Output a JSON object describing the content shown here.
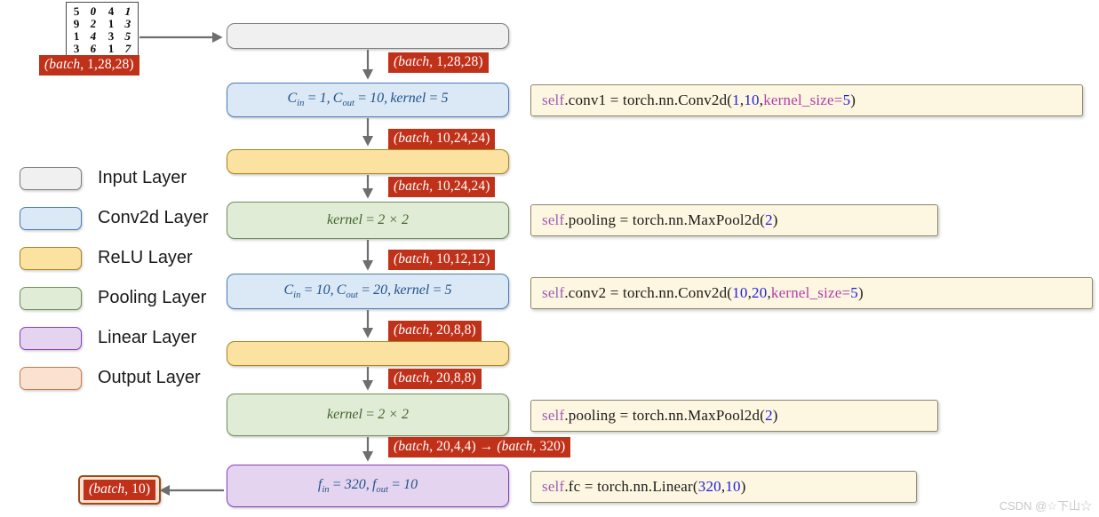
{
  "sample_image": {
    "name": "mnist-digit-grid",
    "rows": [
      [
        "5",
        "0",
        "4",
        "1"
      ],
      [
        "9",
        "2",
        "1",
        "3"
      ],
      [
        "1",
        "4",
        "3",
        "5"
      ],
      [
        "3",
        "6",
        "1",
        "7"
      ]
    ]
  },
  "input_tag": "(batch, 1,28,28)",
  "legend": {
    "items": [
      {
        "label": "Input Layer",
        "color": "#f0f0f0",
        "border": "#7f7f7f"
      },
      {
        "label": "Conv2d Layer",
        "color": "#dbe8f5",
        "border": "#4a7ebb"
      },
      {
        "label": "ReLU Layer",
        "color": "#fbe2a0",
        "border": "#a9861f"
      },
      {
        "label": "Pooling Layer",
        "color": "#e0ecd6",
        "border": "#6f8f5a"
      },
      {
        "label": "Linear Layer",
        "color": "#e5d4f0",
        "border": "#8a3fbd"
      },
      {
        "label": "Output Layer",
        "color": "#fbe2d0",
        "border": "#cd7b4a"
      }
    ]
  },
  "pipeline": {
    "blocks": [
      {
        "kind": "input",
        "label": ""
      },
      {
        "kind": "conv",
        "label": "C_in = 1, C_out = 10, kernel = 5"
      },
      {
        "kind": "relu",
        "label": ""
      },
      {
        "kind": "pool",
        "label": "kernel = 2 × 2"
      },
      {
        "kind": "conv",
        "label": "C_in = 10, C_out = 20, kernel = 5"
      },
      {
        "kind": "relu",
        "label": ""
      },
      {
        "kind": "pool",
        "label": "kernel = 2 × 2"
      },
      {
        "kind": "linear",
        "label": "f_in = 320, f_out = 10"
      }
    ],
    "conv1": {
      "c_in": "1",
      "c_out": "10",
      "kernel": "5"
    },
    "conv2": {
      "c_in": "10",
      "c_out": "20",
      "kernel": "5"
    },
    "pool1": {
      "kernel": "2 × 2"
    },
    "pool2": {
      "kernel": "2 × 2"
    },
    "fc": {
      "f_in": "320",
      "f_out": "10"
    }
  },
  "shape_tags": [
    "(batch, 1,28,28)",
    "(batch, 10,24,24)",
    "(batch, 10,24,24)",
    "(batch, 10,12,12)",
    "(batch, 20,8,8)",
    "(batch, 20,8,8)",
    "(batch, 20,4,4) → (batch, 320)"
  ],
  "output_tag": "(batch, 10)",
  "code": {
    "conv1": {
      "self": "self",
      "attr": ".conv1 = torch.nn.Conv2d(",
      "a1": "1",
      "sep1": ",  ",
      "a2": "10",
      "sep2": ",  ",
      "kw": "kernel_size",
      "eq": "=",
      "a3": "5",
      "close": ")"
    },
    "pool1": {
      "self": "self",
      "attr": ".pooling = torch.nn.MaxPool2d(",
      "a1": "2",
      "close": ")"
    },
    "conv2": {
      "self": "self",
      "attr": ".conv2 = torch.nn.Conv2d(",
      "a1": "10",
      "sep1": ",  ",
      "a2": "20",
      "sep2": ",  ",
      "kw": "kernel_size",
      "eq": "=",
      "a3": "5",
      "close": ")"
    },
    "pool2": {
      "self": "self",
      "attr": ".pooling = torch.nn.MaxPool2d(",
      "a1": "2",
      "close": ")"
    },
    "fc": {
      "self": "self",
      "attr": ".fc = torch.nn.Linear(",
      "a1": "320",
      "sep1": ",  ",
      "a2": "10",
      "close": ")"
    }
  },
  "colors": {
    "tag_bg": "#c0311a",
    "code_bg": "#fdf6e0",
    "arrow": "#6e6e6e",
    "self_kw": "#a05fb4",
    "number": "#2020e0",
    "keyword": "#b040a8"
  },
  "watermark": "CSDN @☆下山☆"
}
